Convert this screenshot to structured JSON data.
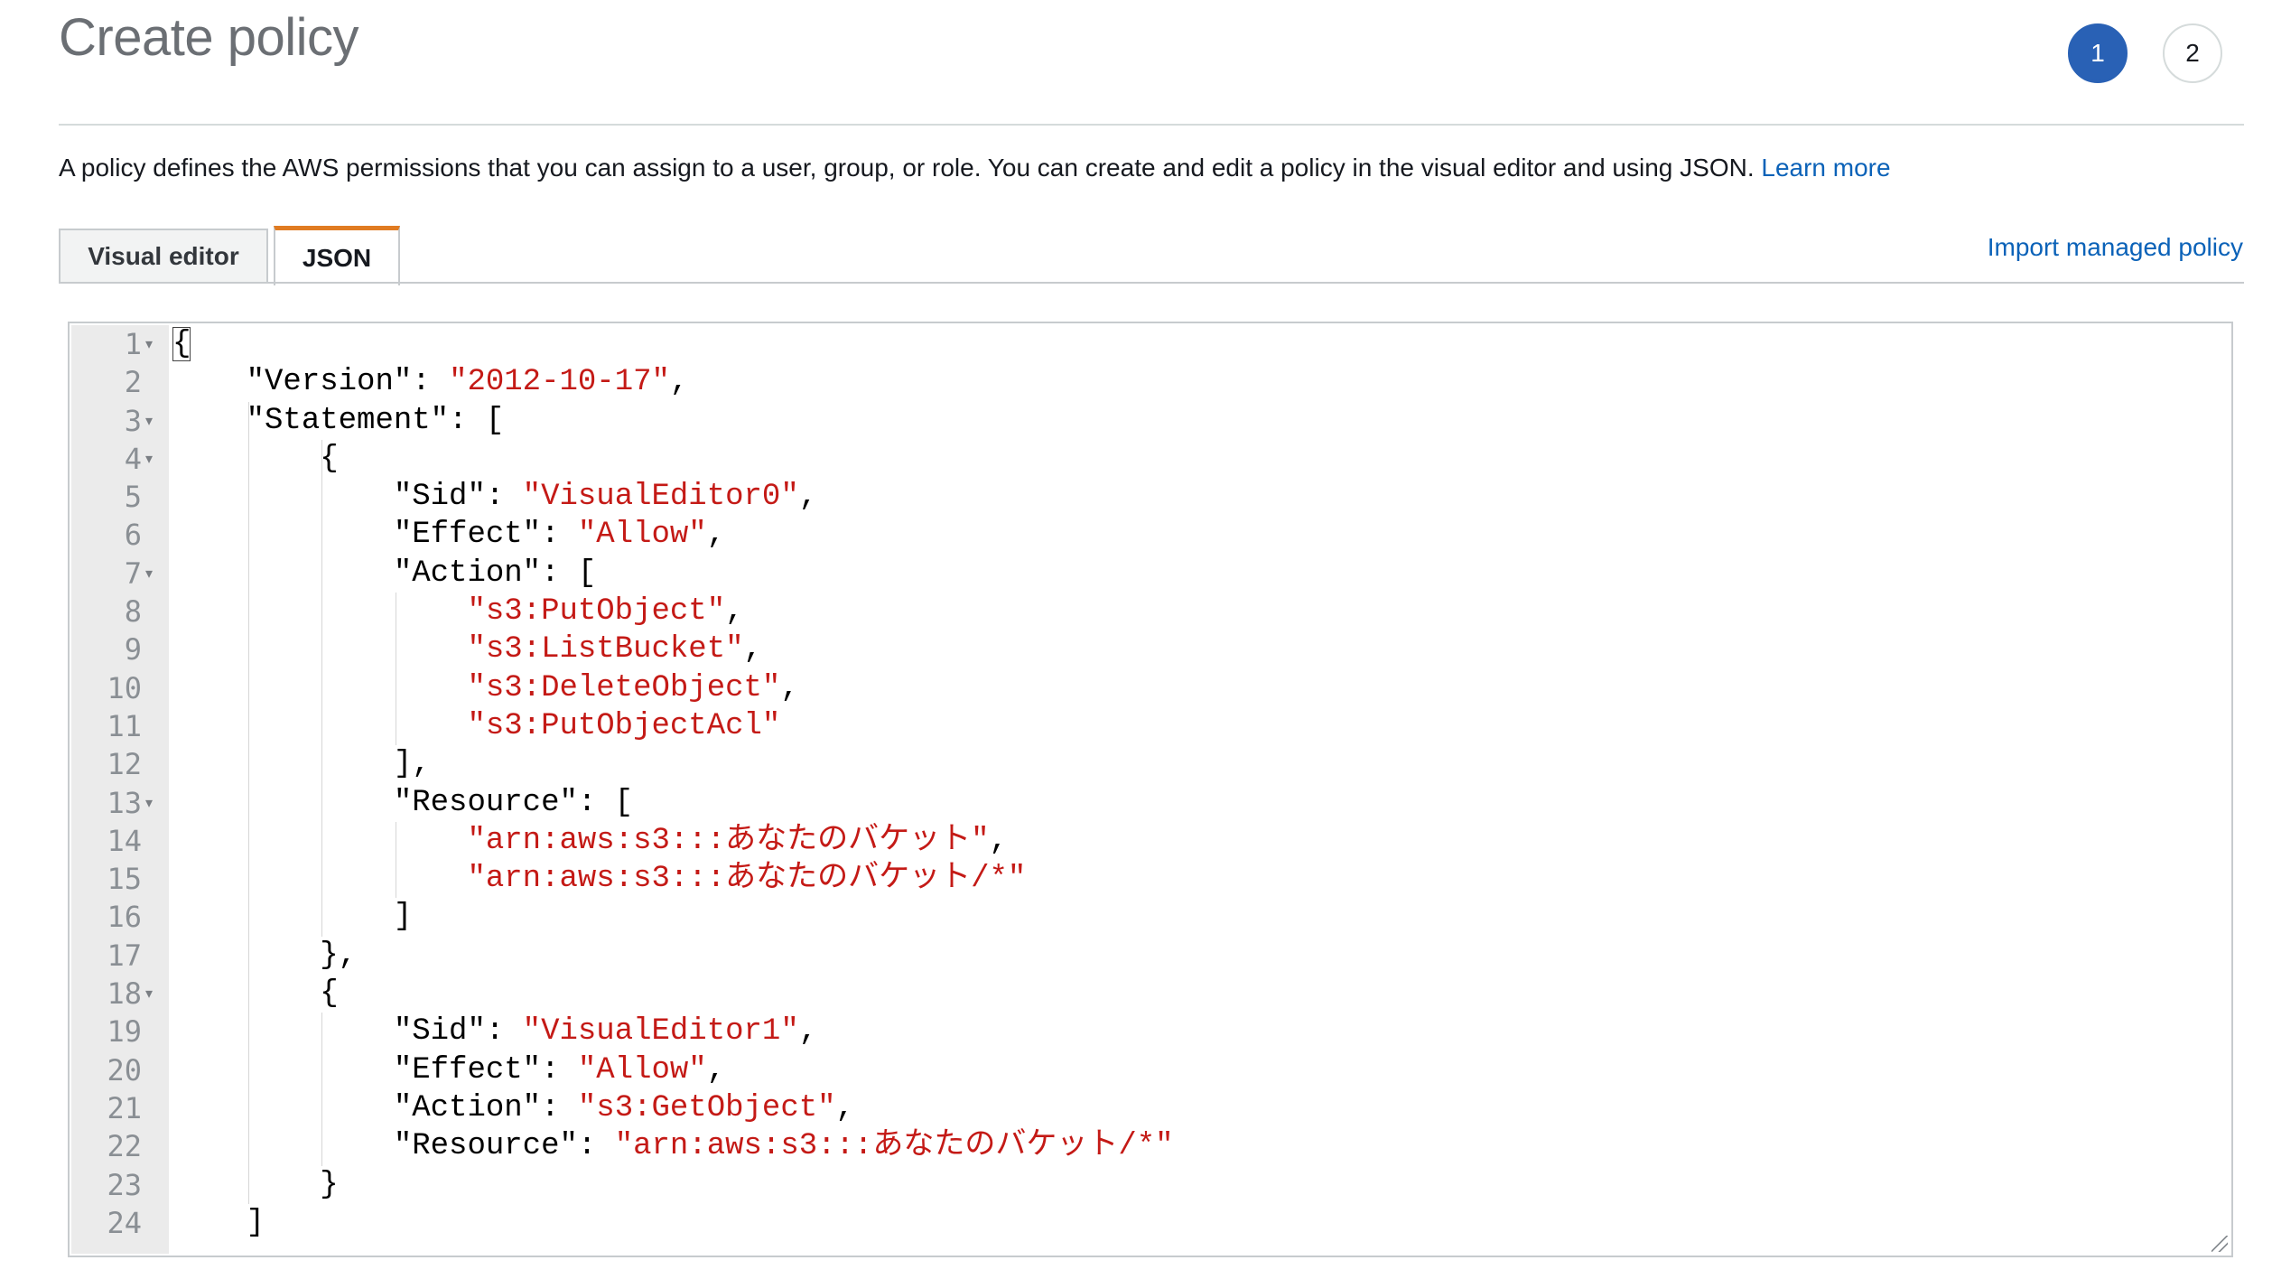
{
  "header": {
    "title": "Create policy",
    "steps": [
      "1",
      "2"
    ],
    "active_step": "1"
  },
  "description": {
    "text": "A policy defines the AWS permissions that you can assign to a user, group, or role. You can create and edit a policy in the visual editor and using JSON. ",
    "learn_more": "Learn more"
  },
  "tabs": [
    {
      "label": "Visual editor",
      "active": false
    },
    {
      "label": "JSON",
      "active": true
    }
  ],
  "import_link": "Import managed policy",
  "editor": {
    "lines": [
      {
        "n": "1",
        "fold": true,
        "indent": 0,
        "tokens": [
          [
            "p",
            "{"
          ]
        ]
      },
      {
        "n": "2",
        "fold": false,
        "indent": 1,
        "tokens": [
          [
            "p",
            "\"Version\": "
          ],
          [
            "s",
            "\"2012-10-17\""
          ],
          [
            "p",
            ","
          ]
        ]
      },
      {
        "n": "3",
        "fold": true,
        "indent": 1,
        "tokens": [
          [
            "p",
            "\"Statement\": ["
          ]
        ]
      },
      {
        "n": "4",
        "fold": true,
        "indent": 2,
        "tokens": [
          [
            "p",
            "{"
          ]
        ]
      },
      {
        "n": "5",
        "fold": false,
        "indent": 3,
        "tokens": [
          [
            "p",
            "\"Sid\": "
          ],
          [
            "s",
            "\"VisualEditor0\""
          ],
          [
            "p",
            ","
          ]
        ]
      },
      {
        "n": "6",
        "fold": false,
        "indent": 3,
        "tokens": [
          [
            "p",
            "\"Effect\": "
          ],
          [
            "s",
            "\"Allow\""
          ],
          [
            "p",
            ","
          ]
        ]
      },
      {
        "n": "7",
        "fold": true,
        "indent": 3,
        "tokens": [
          [
            "p",
            "\"Action\": ["
          ]
        ]
      },
      {
        "n": "8",
        "fold": false,
        "indent": 4,
        "tokens": [
          [
            "s",
            "\"s3:PutObject\""
          ],
          [
            "p",
            ","
          ]
        ]
      },
      {
        "n": "9",
        "fold": false,
        "indent": 4,
        "tokens": [
          [
            "s",
            "\"s3:ListBucket\""
          ],
          [
            "p",
            ","
          ]
        ]
      },
      {
        "n": "10",
        "fold": false,
        "indent": 4,
        "tokens": [
          [
            "s",
            "\"s3:DeleteObject\""
          ],
          [
            "p",
            ","
          ]
        ]
      },
      {
        "n": "11",
        "fold": false,
        "indent": 4,
        "tokens": [
          [
            "s",
            "\"s3:PutObjectAcl\""
          ]
        ]
      },
      {
        "n": "12",
        "fold": false,
        "indent": 3,
        "tokens": [
          [
            "p",
            "],"
          ]
        ]
      },
      {
        "n": "13",
        "fold": true,
        "indent": 3,
        "tokens": [
          [
            "p",
            "\"Resource\": ["
          ]
        ]
      },
      {
        "n": "14",
        "fold": false,
        "indent": 4,
        "tokens": [
          [
            "s",
            "\"arn:aws:s3:::あなたのバケット\""
          ],
          [
            "p",
            ","
          ]
        ]
      },
      {
        "n": "15",
        "fold": false,
        "indent": 4,
        "tokens": [
          [
            "s",
            "\"arn:aws:s3:::あなたのバケット/*\""
          ]
        ]
      },
      {
        "n": "16",
        "fold": false,
        "indent": 3,
        "tokens": [
          [
            "p",
            "]"
          ]
        ]
      },
      {
        "n": "17",
        "fold": false,
        "indent": 2,
        "tokens": [
          [
            "p",
            "},"
          ]
        ]
      },
      {
        "n": "18",
        "fold": true,
        "indent": 2,
        "tokens": [
          [
            "p",
            "{"
          ]
        ]
      },
      {
        "n": "19",
        "fold": false,
        "indent": 3,
        "tokens": [
          [
            "p",
            "\"Sid\": "
          ],
          [
            "s",
            "\"VisualEditor1\""
          ],
          [
            "p",
            ","
          ]
        ]
      },
      {
        "n": "20",
        "fold": false,
        "indent": 3,
        "tokens": [
          [
            "p",
            "\"Effect\": "
          ],
          [
            "s",
            "\"Allow\""
          ],
          [
            "p",
            ","
          ]
        ]
      },
      {
        "n": "21",
        "fold": false,
        "indent": 3,
        "tokens": [
          [
            "p",
            "\"Action\": "
          ],
          [
            "s",
            "\"s3:GetObject\""
          ],
          [
            "p",
            ","
          ]
        ]
      },
      {
        "n": "22",
        "fold": false,
        "indent": 3,
        "tokens": [
          [
            "p",
            "\"Resource\": "
          ],
          [
            "s",
            "\"arn:aws:s3:::あなたのバケット/*\""
          ]
        ]
      },
      {
        "n": "23",
        "fold": false,
        "indent": 2,
        "tokens": [
          [
            "p",
            "}"
          ]
        ]
      },
      {
        "n": "24",
        "fold": false,
        "indent": 1,
        "tokens": [
          [
            "p",
            "]"
          ]
        ]
      }
    ]
  },
  "colors": {
    "accent_blue": "#2961b5",
    "link_blue": "#0b62b8",
    "tab_active_border": "#e07b22",
    "string_red": "#c41a16"
  }
}
